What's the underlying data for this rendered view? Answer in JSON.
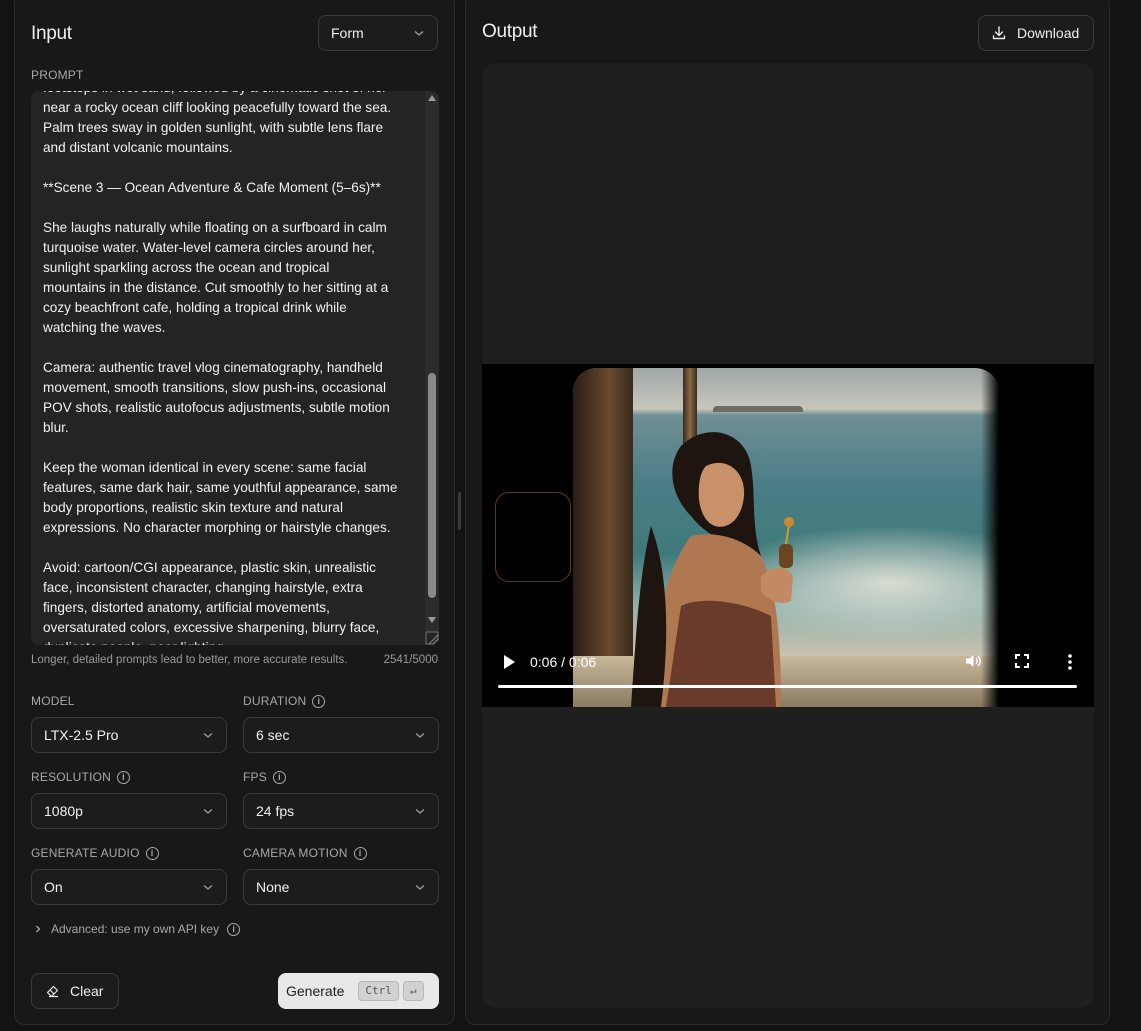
{
  "input": {
    "title": "Input",
    "mode_select": "Form",
    "prompt_label": "PROMPT",
    "prompt_text": "footsteps in wet sand, followed by a cinematic shot of her\nnear a rocky ocean cliff looking peacefully toward the sea.\nPalm trees sway in golden sunlight, with subtle lens flare\nand distant volcanic mountains.\n\n**Scene 3 — Ocean Adventure & Cafe Moment (5–6s)**\n\nShe laughs naturally while floating on a surfboard in calm\nturquoise water. Water-level camera circles around her,\nsunlight sparkling across the ocean and tropical\nmountains in the distance. Cut smoothly to her sitting at a\ncozy beachfront cafe, holding a tropical drink while\nwatching the waves.\n\nCamera: authentic travel vlog cinematography, handheld\nmovement, smooth transitions, slow push-ins, occasional\nPOV shots, realistic autofocus adjustments, subtle motion\nblur.\n\nKeep the woman identical in every scene: same facial\nfeatures, same dark hair, same youthful appearance, same\nbody proportions, realistic skin texture and natural\nexpressions. No character morphing or hairstyle changes.\n\nAvoid: cartoon/CGI appearance, plastic skin, unrealistic\nface, inconsistent character, changing hairstyle, extra\nfingers, distorted anatomy, artificial movements,\noversaturated colors, excessive sharpening, blurry face,\nduplicate people, poor lighting.",
    "prompt_hint": "Longer, detailed prompts lead to better, more accurate results.",
    "char_count": "2541/5000",
    "model": {
      "label": "MODEL",
      "value": "LTX-2.5 Pro"
    },
    "duration": {
      "label": "DURATION",
      "value": "6 sec"
    },
    "resolution": {
      "label": "RESOLUTION",
      "value": "1080p"
    },
    "fps": {
      "label": "FPS",
      "value": "24 fps"
    },
    "generate_audio": {
      "label": "GENERATE AUDIO",
      "value": "On"
    },
    "camera_motion": {
      "label": "CAMERA MOTION",
      "value": "None"
    },
    "advanced_label": "Advanced: use my own API key",
    "clear_label": "Clear",
    "generate_label": "Generate",
    "shortcut_key": "Ctrl",
    "shortcut_enter": "↵"
  },
  "output": {
    "title": "Output",
    "download_label": "Download",
    "video_time": "0:06 / 0:06",
    "video_progress": 1.0
  },
  "colors": {
    "background": "#131313",
    "panel": "#181818",
    "generate_button": "#e8e8e8"
  }
}
